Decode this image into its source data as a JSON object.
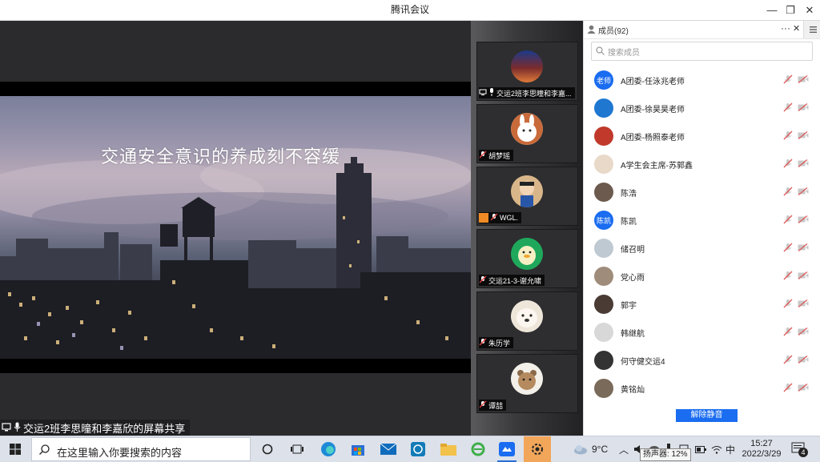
{
  "window": {
    "title": "腾讯会议",
    "min_label": "—",
    "restore_label": "❐",
    "close_label": "✕"
  },
  "stage": {
    "slide_text": "交通安全意识的养成刻不容缓",
    "share_label": "交运2班李思曈和李嘉欣的屏幕共享"
  },
  "participants": [
    {
      "name": "交运2班李思曈和李嘉...",
      "avatar": "city-night-avatar"
    },
    {
      "name": "胡梦瑶",
      "avatar": "rabbit-avatar"
    },
    {
      "name": "WGL.",
      "avatar": "cartoon-boy-avatar"
    },
    {
      "name": "交运21-3-谢允啸",
      "avatar": "duck-avatar"
    },
    {
      "name": "朱历学",
      "avatar": "dog-avatar"
    },
    {
      "name": "谭喆",
      "avatar": "bear-avatar"
    }
  ],
  "members_panel": {
    "title": "成员(92)",
    "more_label": "···",
    "close_label": "✕",
    "search_placeholder": "搜索成员",
    "unmute_all_label": "解除静音",
    "members": [
      {
        "name": "A团委-任泳兆老师",
        "avatar_text": "老师",
        "avatar_color": "#1a6cf0"
      },
      {
        "name": "A团委-徐昊昊老师",
        "avatar_text": "",
        "avatar_color": "#1f77d0"
      },
      {
        "name": "A团委-杨照泰老师",
        "avatar_text": "",
        "avatar_color": "#c0392b"
      },
      {
        "name": "A学生会主席-苏郭鑫",
        "avatar_text": "",
        "avatar_color": "#e8d9c8"
      },
      {
        "name": "陈浩",
        "avatar_text": "",
        "avatar_color": "#6d5a4f"
      },
      {
        "name": "陈凯",
        "avatar_text": "陈凯",
        "avatar_color": "#1a6cf0"
      },
      {
        "name": "储召明",
        "avatar_text": "",
        "avatar_color": "#bfc9d2"
      },
      {
        "name": "党心雨",
        "avatar_text": "",
        "avatar_color": "#a08c7a"
      },
      {
        "name": "郭宇",
        "avatar_text": "",
        "avatar_color": "#4a3b35"
      },
      {
        "name": "韩继航",
        "avatar_text": "",
        "avatar_color": "#d8d8d8"
      },
      {
        "name": "何守健交运4",
        "avatar_text": "",
        "avatar_color": "#333333"
      },
      {
        "name": "黄铭灿",
        "avatar_text": "",
        "avatar_color": "#7a6a5a"
      }
    ]
  },
  "taskbar": {
    "search_placeholder": "在这里输入你要搜索的内容",
    "weather": "9°C",
    "ime": "中",
    "time": "15:27",
    "date": "2022/3/29",
    "notification_count": "4",
    "volume_tooltip": "扬声器: 12%"
  }
}
